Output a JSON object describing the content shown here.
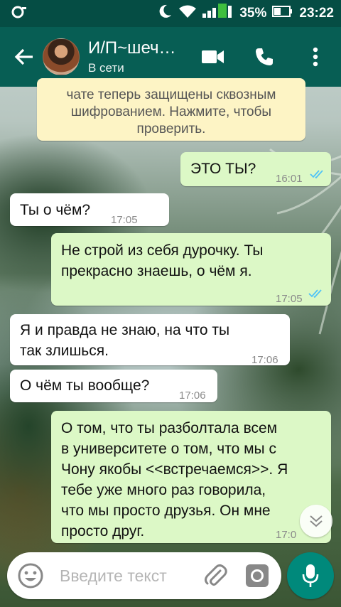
{
  "status_bar": {
    "battery": "35%",
    "time": "23:22",
    "network_badge": "2"
  },
  "header": {
    "contact_name": "И/П~шеч…",
    "contact_status": "В сети",
    "back_icon": "arrow-back-icon",
    "video_icon": "video-call-icon",
    "call_icon": "phone-icon",
    "menu_icon": "more-vert-icon"
  },
  "system_notice": {
    "line1": "чате теперь защищены сквозным",
    "line2": "шифрованием. Нажмите, чтобы",
    "line3": "проверить."
  },
  "messages": [
    {
      "dir": "out",
      "lines": [
        "ЭТО ТЫ?"
      ],
      "time": "16:01",
      "read": true
    },
    {
      "dir": "in",
      "lines": [
        "Ты о чём?"
      ],
      "time": "17:05"
    },
    {
      "dir": "out",
      "lines": [
        "Не строй из себя дурочку. Ты",
        "прекрасно знаешь, о чём я."
      ],
      "time": "17:05",
      "read": true
    },
    {
      "dir": "in",
      "lines": [
        "Я и правда не знаю, на что ты",
        "так злишься."
      ],
      "time": "17:06"
    },
    {
      "dir": "in",
      "lines": [
        "О чём ты вообще?"
      ],
      "time": "17:06"
    },
    {
      "dir": "out",
      "lines": [
        "О том, что ты разболтала всем",
        "в университете о том, что мы с",
        "Чону якобы <<встречаемся>>. Я",
        "тебе уже много раз говорила,",
        "что мы просто друзья. Он мне",
        "просто друг."
      ],
      "time": "17:0"
    }
  ],
  "input": {
    "placeholder": "Введите текст",
    "emoji_icon": "emoji-icon",
    "attach_icon": "paperclip-icon",
    "camera_icon": "camera-icon",
    "mic_icon": "microphone-icon"
  },
  "colors": {
    "header": "#075e54",
    "status_bar": "#054d44",
    "outgoing_bubble": "#dcf8c6",
    "incoming_bubble": "#ffffff",
    "notice_bubble": "#fdf4c5",
    "read_ticks": "#4fc3f7",
    "mic_button": "#00897b"
  }
}
